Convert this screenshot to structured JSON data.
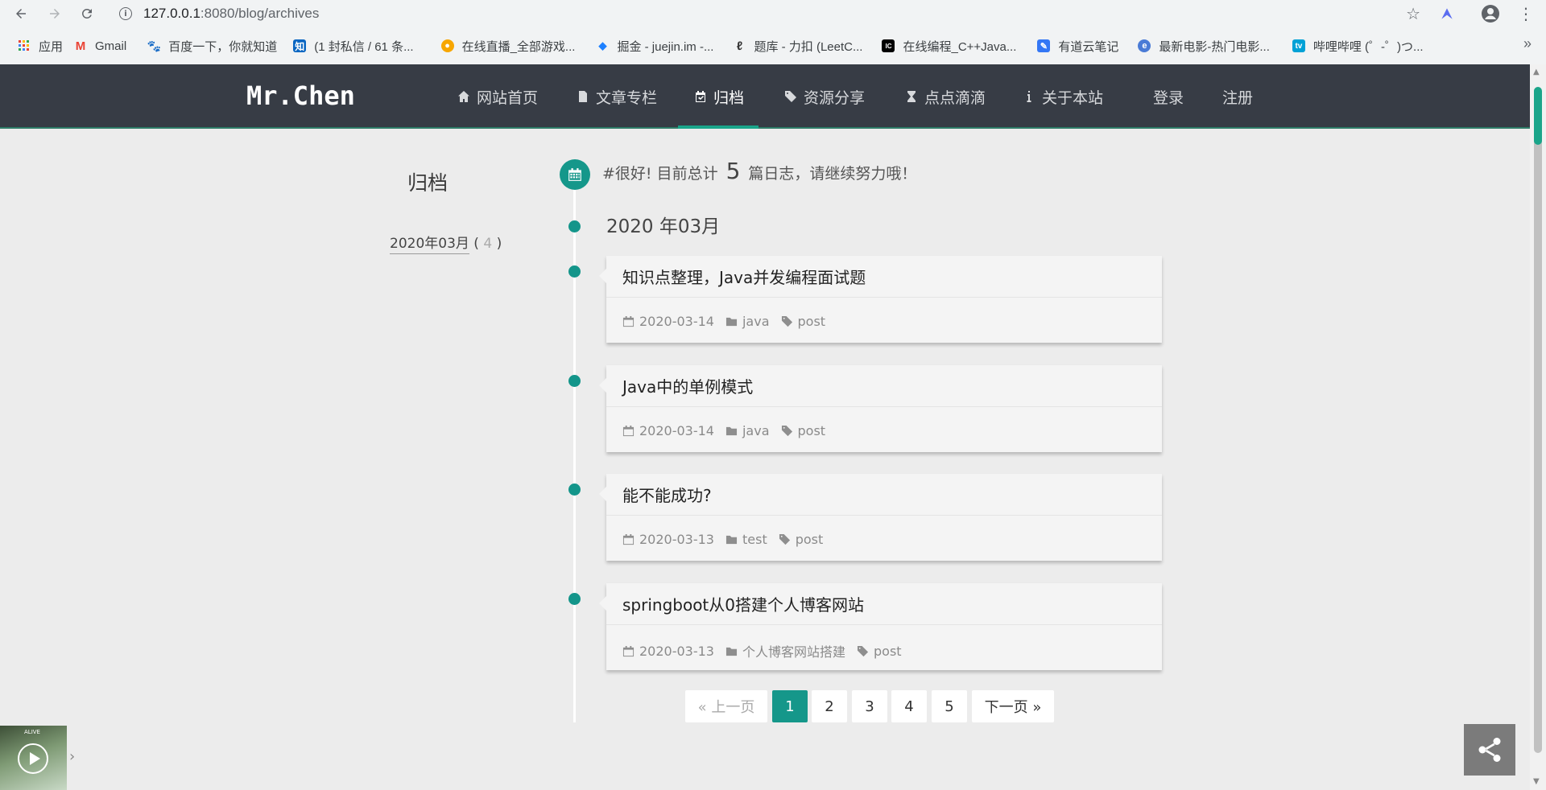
{
  "browser": {
    "url_host": "127.0.0.1",
    "url_path": ":8080/blog/archives",
    "bookmarks": [
      {
        "label": "应用",
        "icon": "apps-grid-icon",
        "color": "#4285f4"
      },
      {
        "label": "Gmail",
        "icon": "gmail-icon",
        "color": "#ea4335"
      },
      {
        "label": "百度一下，你就知道",
        "icon": "baidu-paw-icon",
        "color": "#2932e1"
      },
      {
        "label": "(1 封私信 / 61 条...",
        "icon": "zhihu-icon",
        "color": "#0a66c2"
      },
      {
        "label": "在线直播_全部游戏...",
        "icon": "huya-icon",
        "color": "#f7a600"
      },
      {
        "label": "掘金 - juejin.im -...",
        "icon": "juejin-icon",
        "color": "#1e80ff"
      },
      {
        "label": "题库 - 力扣 (LeetC...",
        "icon": "leetcode-icon",
        "color": "#ffa116"
      },
      {
        "label": "在线编程_C++Java...",
        "icon": "codefun-icon",
        "color": "#000000"
      },
      {
        "label": "有道云笔记",
        "icon": "youdao-note-icon",
        "color": "#3477f5"
      },
      {
        "label": "最新电影-热门电影...",
        "icon": "movie-site-icon",
        "color": "#4a7bd6"
      },
      {
        "label": "哔哩哔哩 (゜-゜)つ...",
        "icon": "bilibili-icon",
        "color": "#00a1d6"
      }
    ]
  },
  "site": {
    "logo": "Mr.Chen",
    "nav": [
      {
        "label": "网站首页",
        "icon": "home-icon"
      },
      {
        "label": "文章专栏",
        "icon": "document-icon"
      },
      {
        "label": "归档",
        "icon": "calendar-check-icon",
        "active": true
      },
      {
        "label": "资源分享",
        "icon": "tags-icon"
      },
      {
        "label": "点点滴滴",
        "icon": "hourglass-icon"
      },
      {
        "label": "关于本站",
        "icon": "info-icon"
      },
      {
        "label": "登录",
        "icon": ""
      },
      {
        "label": "注册",
        "icon": ""
      }
    ],
    "accent_color": "#15978a",
    "navbar_color": "#373c45"
  },
  "sidebar": {
    "title": "归档",
    "link_label": "2020年03月",
    "link_open": " ( ",
    "link_count": "4",
    "link_close": " )"
  },
  "summary": {
    "prefix": "#很好! 目前总计",
    "count": "5",
    "suffix": "篇日志，请继续努力哦！"
  },
  "timeline": {
    "month": "2020 年03月",
    "posts": [
      {
        "title": "知识点整理，Java并发编程面试题",
        "date": "2020-03-14",
        "category": "java",
        "tag": "post"
      },
      {
        "title": "Java中的单例模式",
        "date": "2020-03-14",
        "category": "java",
        "tag": "post"
      },
      {
        "title": "能不能成功?",
        "date": "2020-03-13",
        "category": "test",
        "tag": "post"
      },
      {
        "title": "springboot从0搭建个人博客网站",
        "date": "2020-03-13",
        "category": "个人博客网站搭建",
        "tag": "post"
      }
    ]
  },
  "pagination": {
    "prev": "« 上一页",
    "pages": [
      "1",
      "2",
      "3",
      "4",
      "5"
    ],
    "current": "1",
    "next": "下一页 »"
  },
  "widgets": {
    "music_title": "ALIVE"
  }
}
